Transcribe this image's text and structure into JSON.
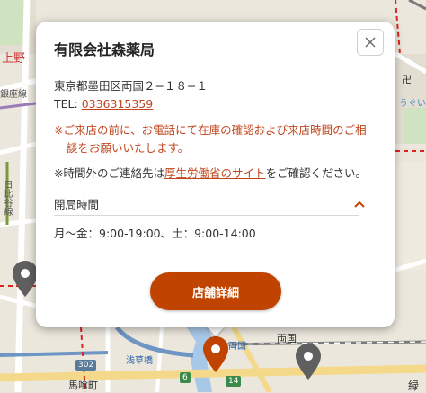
{
  "map": {
    "labels": {
      "ueno": "上野",
      "ginza": "銀座線",
      "hibiya": "日比谷線",
      "ryogoku_station": "両国",
      "ryogoku_area": "両国",
      "asakusabashi": "浅草橋",
      "bakurocho": "馬喰町",
      "midori": "緑",
      "uguisu": "うぐいす",
      "temple_mark": "卍"
    },
    "shields": {
      "r302": "302",
      "r6": "6",
      "r14": "14"
    }
  },
  "popup": {
    "title": "有限会社森薬局",
    "address": "東京都墨田区両国２−１８−１",
    "tel_label": "TEL: ",
    "tel_number": "0336315359",
    "notice_red": "※ご来店の前に、お電話にて在庫の確認および来店時間のご相談をお願いいたします。",
    "notice_prefix": "※時間外のご連絡先は",
    "notice_link": "厚生労働省のサイト",
    "notice_suffix": "をご確認ください。",
    "hours_label": "開局時間",
    "hours_value": "月〜金：9:00-19:00、土：9:00-14:00",
    "detail_button": "店舗詳細"
  },
  "colors": {
    "accent": "#c04400",
    "link": "#c0451c"
  }
}
